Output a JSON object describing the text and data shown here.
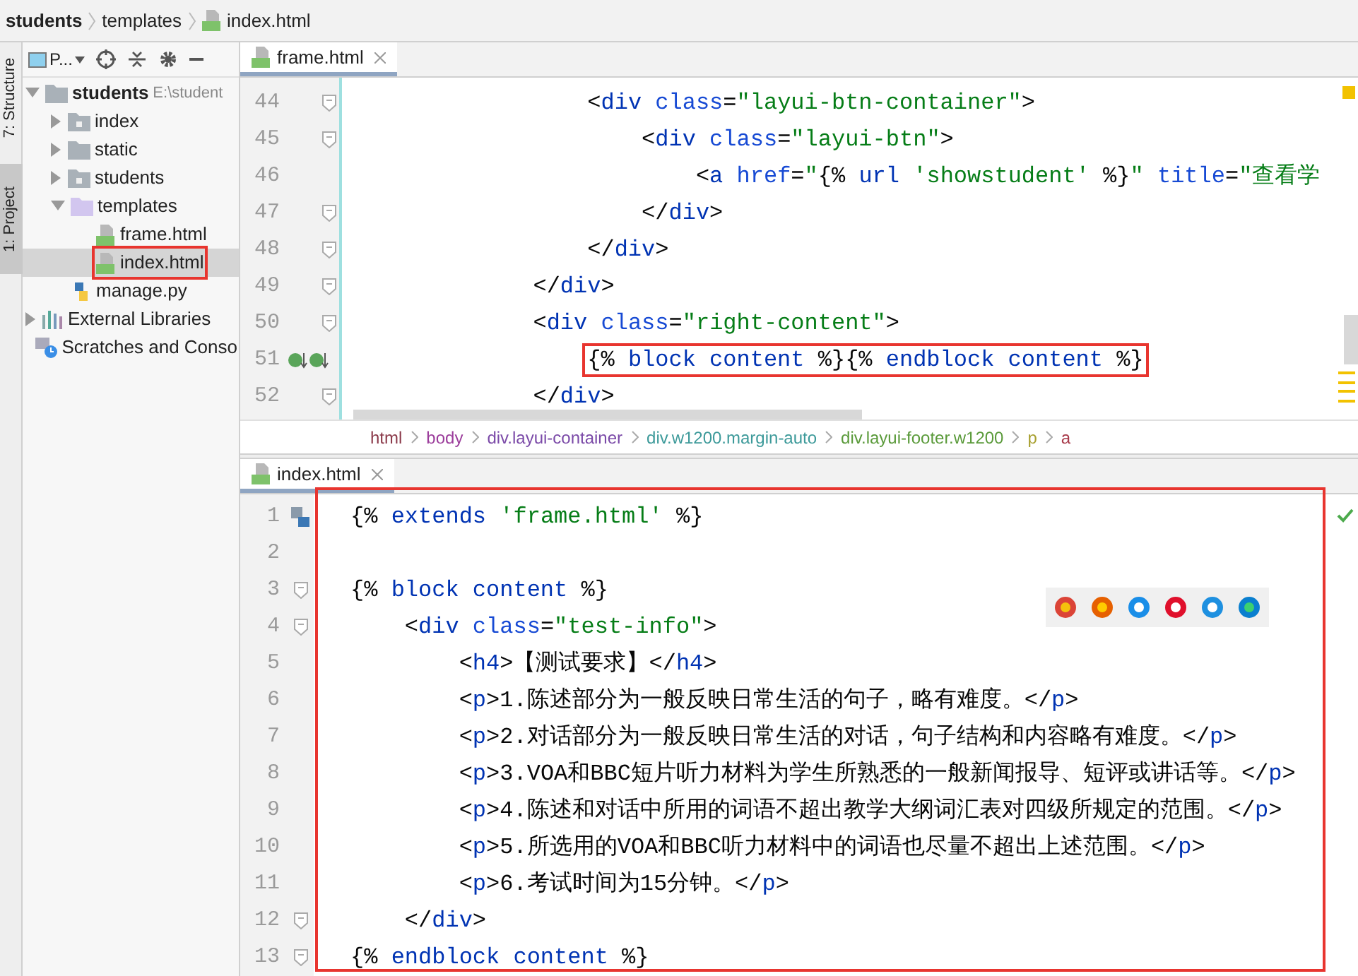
{
  "breadcrumb": [
    {
      "label": "students",
      "kind": "project"
    },
    {
      "label": "templates",
      "kind": "folder"
    },
    {
      "label": "index.html",
      "kind": "html"
    }
  ],
  "side_tabs": [
    {
      "label": "7: Structure",
      "selected": false
    },
    {
      "label": "1: Project",
      "selected": true
    }
  ],
  "project_panel": {
    "view_label": "P...",
    "tree": [
      {
        "label": "students",
        "path": "E:\\student",
        "kind": "project",
        "expanded": true,
        "selected": false,
        "annotated": false,
        "children": [
          {
            "label": "index",
            "kind": "module",
            "expanded": false,
            "selected": false,
            "annotated": false
          },
          {
            "label": "static",
            "kind": "folder",
            "expanded": false,
            "selected": false,
            "annotated": false
          },
          {
            "label": "students",
            "kind": "module",
            "expanded": false,
            "selected": false,
            "annotated": false
          },
          {
            "label": "templates",
            "kind": "templates",
            "expanded": true,
            "selected": false,
            "annotated": false,
            "children": [
              {
                "label": "frame.html",
                "kind": "html",
                "selected": false,
                "annotated": false
              },
              {
                "label": "index.html",
                "kind": "html",
                "selected": true,
                "annotated": true
              }
            ]
          },
          {
            "label": "manage.py",
            "kind": "python",
            "selected": false,
            "annotated": false
          }
        ]
      },
      {
        "label": "External Libraries",
        "kind": "libraries",
        "expanded": false,
        "selected": false,
        "annotated": false
      },
      {
        "label": "Scratches and Conso",
        "kind": "scratches",
        "selected": false,
        "annotated": false
      }
    ]
  },
  "top_editor": {
    "tab": {
      "label": "frame.html",
      "selected": true
    },
    "lines": [
      {
        "number": "44",
        "fold": true,
        "tokens": [
          {
            "kind": "plain",
            "text": "                <"
          },
          {
            "kind": "tag",
            "text": "div"
          },
          {
            "kind": "attr",
            "text": " class"
          },
          {
            "kind": "plain",
            "text": "="
          },
          {
            "kind": "string",
            "text": "\"layui-btn-container\""
          },
          {
            "kind": "plain",
            "text": ">"
          }
        ]
      },
      {
        "number": "45",
        "fold": true,
        "tokens": [
          {
            "kind": "plain",
            "text": "                    <"
          },
          {
            "kind": "tag",
            "text": "div"
          },
          {
            "kind": "attr",
            "text": " class"
          },
          {
            "kind": "plain",
            "text": "="
          },
          {
            "kind": "string",
            "text": "\"layui-btn\""
          },
          {
            "kind": "plain",
            "text": ">"
          }
        ]
      },
      {
        "number": "46",
        "fold": false,
        "tokens": [
          {
            "kind": "plain",
            "text": "                        <"
          },
          {
            "kind": "tag",
            "text": "a"
          },
          {
            "kind": "attr",
            "text": " href"
          },
          {
            "kind": "plain",
            "text": "="
          },
          {
            "kind": "string",
            "text": "\""
          },
          {
            "kind": "plain",
            "text": "{% "
          },
          {
            "kind": "keyword",
            "text": "url"
          },
          {
            "kind": "string",
            "text": " 'showstudent'"
          },
          {
            "kind": "plain",
            "text": " %}"
          },
          {
            "kind": "string",
            "text": "\""
          },
          {
            "kind": "attr",
            "text": " title"
          },
          {
            "kind": "plain",
            "text": "="
          },
          {
            "kind": "string",
            "text": "\"查看学"
          }
        ]
      },
      {
        "number": "47",
        "fold": true,
        "tokens": [
          {
            "kind": "plain",
            "text": "                    </"
          },
          {
            "kind": "tag",
            "text": "div"
          },
          {
            "kind": "plain",
            "text": ">"
          }
        ]
      },
      {
        "number": "48",
        "fold": true,
        "tokens": [
          {
            "kind": "plain",
            "text": "                </"
          },
          {
            "kind": "tag",
            "text": "div"
          },
          {
            "kind": "plain",
            "text": ">"
          }
        ]
      },
      {
        "number": "49",
        "fold": true,
        "tokens": [
          {
            "kind": "plain",
            "text": "            </"
          },
          {
            "kind": "tag",
            "text": "div"
          },
          {
            "kind": "plain",
            "text": ">"
          }
        ]
      },
      {
        "number": "50",
        "fold": true,
        "tokens": [
          {
            "kind": "plain",
            "text": "            <"
          },
          {
            "kind": "tag",
            "text": "div"
          },
          {
            "kind": "attr",
            "text": " class"
          },
          {
            "kind": "plain",
            "text": "="
          },
          {
            "kind": "string",
            "text": "\"right-content\""
          },
          {
            "kind": "plain",
            "text": ">"
          }
        ]
      },
      {
        "number": "51",
        "fold": false,
        "markers": true,
        "annotated": true,
        "tokens": [
          {
            "kind": "plain",
            "text": "                {% "
          },
          {
            "kind": "keyword",
            "text": "block content"
          },
          {
            "kind": "plain",
            "text": " %}{% "
          },
          {
            "kind": "keyword",
            "text": "endblock content"
          },
          {
            "kind": "plain",
            "text": " %}"
          }
        ]
      },
      {
        "number": "52",
        "fold": true,
        "tokens": [
          {
            "kind": "plain",
            "text": "            </"
          },
          {
            "kind": "tag",
            "text": "div"
          },
          {
            "kind": "plain",
            "text": ">"
          }
        ]
      }
    ],
    "path": [
      {
        "label": "html",
        "color": "#8b3a4a"
      },
      {
        "label": "body",
        "color": "#9b3c9b"
      },
      {
        "label": "div.layui-container",
        "color": "#7b4aa8"
      },
      {
        "label": "div.w1200.margin-auto",
        "color": "#3d9a9a"
      },
      {
        "label": "div.layui-footer.w1200",
        "color": "#5a9a3a"
      },
      {
        "label": "p",
        "color": "#a8a030"
      },
      {
        "label": "a",
        "color": "#a83a4a"
      }
    ]
  },
  "bottom_editor": {
    "tab": {
      "label": "index.html",
      "selected": true
    },
    "annotated": true,
    "lines": [
      {
        "number": "1",
        "fold": false,
        "tokens": [
          {
            "kind": "plain",
            "text": "{% "
          },
          {
            "kind": "keyword",
            "text": "extends"
          },
          {
            "kind": "string",
            "text": " 'frame.html'"
          },
          {
            "kind": "plain",
            "text": " %}"
          }
        ]
      },
      {
        "number": "2",
        "fold": false
      },
      {
        "number": "3",
        "fold": true,
        "tokens": [
          {
            "kind": "plain",
            "text": "{% "
          },
          {
            "kind": "keyword",
            "text": "block content"
          },
          {
            "kind": "plain",
            "text": " %}"
          }
        ]
      },
      {
        "number": "4",
        "fold": true,
        "tokens": [
          {
            "kind": "plain",
            "text": "    <"
          },
          {
            "kind": "tag",
            "text": "div"
          },
          {
            "kind": "attr",
            "text": " class"
          },
          {
            "kind": "plain",
            "text": "="
          },
          {
            "kind": "string",
            "text": "\"test-info\""
          },
          {
            "kind": "plain",
            "text": ">"
          }
        ]
      },
      {
        "number": "5",
        "fold": false,
        "tokens": [
          {
            "kind": "plain",
            "text": "        <"
          },
          {
            "kind": "tag",
            "text": "h4"
          },
          {
            "kind": "plain",
            "text": ">【测试要求】</"
          },
          {
            "kind": "tag",
            "text": "h4"
          },
          {
            "kind": "plain",
            "text": ">"
          }
        ]
      },
      {
        "number": "6",
        "fold": false,
        "tokens": [
          {
            "kind": "plain",
            "text": "        <"
          },
          {
            "kind": "tag",
            "text": "p"
          },
          {
            "kind": "plain",
            "text": ">1.陈述部分为一般反映日常生活的句子，略有难度。</"
          },
          {
            "kind": "tag",
            "text": "p"
          },
          {
            "kind": "plain",
            "text": ">"
          }
        ]
      },
      {
        "number": "7",
        "fold": false,
        "tokens": [
          {
            "kind": "plain",
            "text": "        <"
          },
          {
            "kind": "tag",
            "text": "p"
          },
          {
            "kind": "plain",
            "text": ">2.对话部分为一般反映日常生活的对话，句子结构和内容略有难度。</"
          },
          {
            "kind": "tag",
            "text": "p"
          },
          {
            "kind": "plain",
            "text": ">"
          }
        ]
      },
      {
        "number": "8",
        "fold": false,
        "tokens": [
          {
            "kind": "plain",
            "text": "        <"
          },
          {
            "kind": "tag",
            "text": "p"
          },
          {
            "kind": "plain",
            "text": ">3.VOA和BBC短片听力材料为学生所熟悉的一般新闻报导、短评或讲话等。</"
          },
          {
            "kind": "tag",
            "text": "p"
          },
          {
            "kind": "plain",
            "text": ">"
          }
        ]
      },
      {
        "number": "9",
        "fold": false,
        "tokens": [
          {
            "kind": "plain",
            "text": "        <"
          },
          {
            "kind": "tag",
            "text": "p"
          },
          {
            "kind": "plain",
            "text": ">4.陈述和对话中所用的词语不超出教学大纲词汇表对四级所规定的范围。</"
          },
          {
            "kind": "tag",
            "text": "p"
          },
          {
            "kind": "plain",
            "text": ">"
          }
        ]
      },
      {
        "number": "10",
        "fold": false,
        "tokens": [
          {
            "kind": "plain",
            "text": "        <"
          },
          {
            "kind": "tag",
            "text": "p"
          },
          {
            "kind": "plain",
            "text": ">5.所选用的VOA和BBC听力材料中的词语也尽量不超出上述范围。</"
          },
          {
            "kind": "tag",
            "text": "p"
          },
          {
            "kind": "plain",
            "text": ">"
          }
        ]
      },
      {
        "number": "11",
        "fold": false,
        "tokens": [
          {
            "kind": "plain",
            "text": "        <"
          },
          {
            "kind": "tag",
            "text": "p"
          },
          {
            "kind": "plain",
            "text": ">6.考试时间为15分钟。</"
          },
          {
            "kind": "tag",
            "text": "p"
          },
          {
            "kind": "plain",
            "text": ">"
          }
        ]
      },
      {
        "number": "12",
        "fold": true,
        "tokens": [
          {
            "kind": "plain",
            "text": "    </"
          },
          {
            "kind": "tag",
            "text": "div"
          },
          {
            "kind": "plain",
            "text": ">"
          }
        ]
      },
      {
        "number": "13",
        "fold": true,
        "tokens": [
          {
            "kind": "plain",
            "text": "{% "
          },
          {
            "kind": "keyword",
            "text": "endblock content"
          },
          {
            "kind": "plain",
            "text": " %}"
          }
        ]
      }
    ]
  }
}
